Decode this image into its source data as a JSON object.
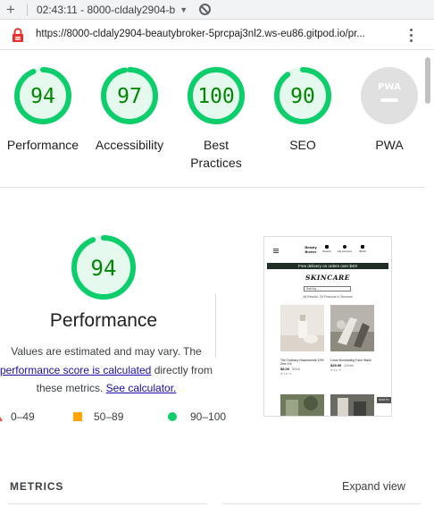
{
  "browser": {
    "tab_title": "02:43:11 - 8000-cldaly2904-b",
    "url": "https://8000-cldaly2904-beautybroker-5prcpaj3nl2.ws-eu86.gitpod.io/pr..."
  },
  "categories": [
    {
      "label": "Performance",
      "score": "94",
      "value": 94
    },
    {
      "label": "Accessibility",
      "score": "97",
      "value": 97
    },
    {
      "label": "Best Practices",
      "score": "100",
      "value": 100
    },
    {
      "label": "SEO",
      "score": "90",
      "value": 90
    },
    {
      "label": "PWA",
      "score": "PWA"
    }
  ],
  "performance": {
    "score": "94",
    "value": 94,
    "title": "Performance",
    "desc_line1": "Values are estimated and may vary. The",
    "link_score": "performance score is calculated",
    "desc_mid": " directly from",
    "desc_line3": "these metrics. ",
    "link_calc": "See calculator."
  },
  "legend": [
    {
      "range": "0–49",
      "color": "#ff4e42"
    },
    {
      "range": "50–89",
      "color": "#ffa400"
    },
    {
      "range": "90–100",
      "color": "#0cce6b"
    }
  ],
  "thumbnail": {
    "brand": "Beauty Broker",
    "icons": [
      "Search",
      "My Account",
      "$0.00"
    ],
    "banner": "Free delivery on orders over $40!",
    "title": "SKINCARE",
    "sort": "Sort by...",
    "count": "All Results: 26 Products in Skincare",
    "products": [
      {
        "name": "The Ordinary Niacinamide 10% Zinc 1%",
        "price": "$8.00",
        "size": "30ml",
        "meta": "★ 4.5 / 5"
      },
      {
        "name": "Lotus Illuminating Face Wash",
        "price": "$29.99",
        "size": "100ml",
        "meta": "★ 4.2 / 5"
      }
    ],
    "badge": "BACK TO TOP"
  },
  "metrics": {
    "title": "METRICS",
    "expand": "Expand view"
  },
  "colors": {
    "pass": "#0cce6b",
    "pass_fill": "#e5f9ee",
    "pass_text": "#008800",
    "na": "#e0e0e0",
    "link": "#1a0dab"
  }
}
